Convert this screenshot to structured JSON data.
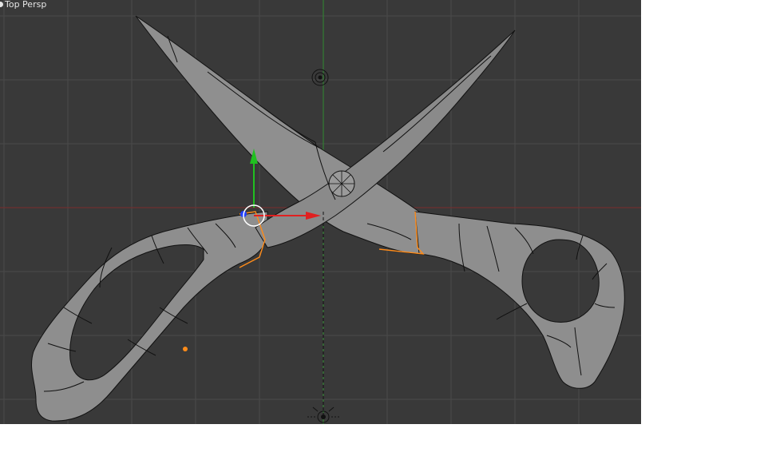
{
  "viewport": {
    "view_label": "Top Persp",
    "background_color": "#393939",
    "grid_color": "#4a4a4a",
    "x_axis_color": "#7a2d2d",
    "y_axis_color": "#2f8a2f"
  },
  "scene": {
    "object": "scissors-mesh",
    "mesh_color": "#8e8e8e",
    "wire_color": "#111111",
    "selection_color": "#ff8c1a",
    "gizmo": {
      "x_color": "#e02020",
      "y_color": "#20c020",
      "z_color": "#2040ff",
      "center_color": "#ffffff"
    },
    "camera_icon": "camera-target-icon",
    "light_icon": "light-icon",
    "origin_icon": "object-origin-icon"
  }
}
